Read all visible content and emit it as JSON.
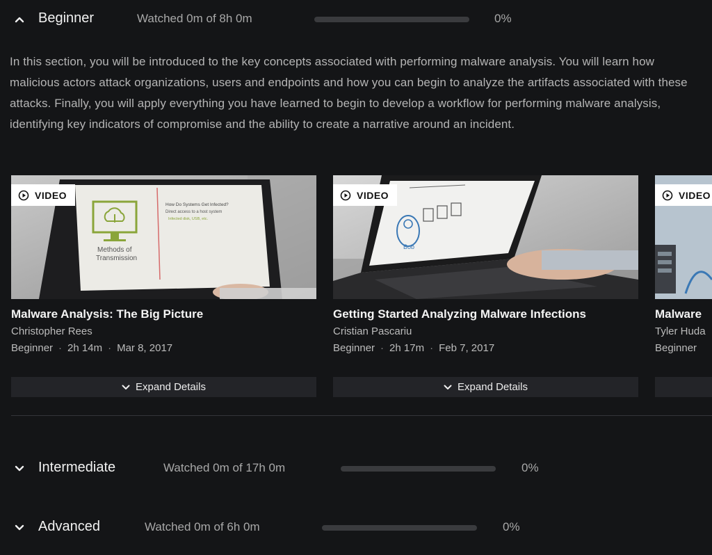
{
  "sections": {
    "beginner": {
      "title": "Beginner",
      "watched": "Watched 0m of 8h 0m",
      "progress": 0,
      "percent": "0%",
      "expanded": true,
      "description": "In this section, you will be introduced to the key concepts associated with performing malware analysis. You will learn how malicious actors attack organizations, users and endpoints and how you can begin to analyze the artifacts associated with these attacks. Finally, you will apply everything you have learned to begin to develop a workflow for performing malware analysis, identifying key indicators of compromise and the ability to create a narrative around an incident."
    },
    "intermediate": {
      "title": "Intermediate",
      "watched": "Watched 0m of 17h 0m",
      "progress": 0,
      "percent": "0%",
      "expanded": false
    },
    "advanced": {
      "title": "Advanced",
      "watched": "Watched 0m of 6h 0m",
      "progress": 0,
      "percent": "0%",
      "expanded": false
    }
  },
  "cards": [
    {
      "badge": "VIDEO",
      "title": "Malware Analysis: The Big Picture",
      "author": "Christopher Rees",
      "level": "Beginner",
      "duration": "2h 14m",
      "date": "Mar 8, 2017",
      "expand_label": "Expand Details",
      "thumb_caption": "Methods of Transmission",
      "thumb_heading": "How Do Systems Get Infected?",
      "thumb_bullet1": "Direct access to a host system",
      "thumb_bullet2": "Infected disk, USB, etc."
    },
    {
      "badge": "VIDEO",
      "title": "Getting Started Analyzing Malware Infections",
      "author": "Cristian Pascariu",
      "level": "Beginner",
      "duration": "2h 17m",
      "date": "Feb 7, 2017",
      "expand_label": "Expand Details",
      "thumb_caption": "Bob"
    },
    {
      "badge": "VIDEO",
      "title": "Malware",
      "author": "Tyler Huda",
      "level": "Beginner",
      "duration": "",
      "date": "",
      "expand_label": ""
    }
  ],
  "meta_separator": "·",
  "colors": {
    "background": "#141517",
    "progress_track": "#3a3b3e",
    "card_button": "#232428",
    "badge_bg": "#ffffff",
    "thumb_accent_green": "#8aa53a",
    "thumb_accent_blue": "#3a78b5"
  },
  "icons": {
    "collapse": "chevron-up-icon",
    "expand": "chevron-down-icon",
    "badge": "play-circle-icon"
  }
}
